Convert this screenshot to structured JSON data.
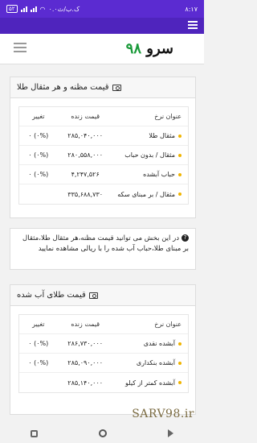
{
  "statusbar": {
    "time": "۸:۱۷",
    "speed": "۰.۰ک.ب/ث",
    "battery": "۵۲"
  },
  "header": {
    "logo_text": "سرو",
    "logo_num": "۹۸"
  },
  "gold_card": {
    "title": "قیمت مظنه و هر مثقال طلا",
    "columns": {
      "name": "عنوان نرخ",
      "price": "قیمت زنده",
      "change": "تغییر"
    },
    "rows": [
      {
        "name": "مثقال طلا",
        "price": "۲۸۵,۰۴۰,۰۰۰",
        "change": "(۰%) ۰"
      },
      {
        "name": "مثقال / بدون حباب",
        "price": "۲۸۰,۵۵۸,۰۰۰",
        "change": "(۰%) ۰"
      },
      {
        "name": "حباب آبشده",
        "price": "۴,۲۴۷,۵۲۶",
        "change": "(۰%) ۰"
      },
      {
        "name": "مثقال / بر مبنای سکه",
        "price": "۳۳۵,۶۸۸,۷۳۰",
        "change": ""
      }
    ]
  },
  "notice": {
    "text": "در این بخش می توانید قیمت مظنه،هر مثقال طلا،مثقال بر مبنای طلا،حباب آب شده را با ریالی مشاهده نمایید"
  },
  "melted_card": {
    "title": "قیمت طلای آب شده",
    "columns": {
      "name": "عنوان نرخ",
      "price": "قیمت زنده",
      "change": "تغییر"
    },
    "rows": [
      {
        "name": "آبشده نقدی",
        "price": "۲۸۶,۷۳۰,۰۰۰",
        "change": "(۰%) ۰"
      },
      {
        "name": "آبشده بنکداری",
        "price": "۲۸۵,۰۹۰,۰۰۰",
        "change": "(۰%) ۰"
      },
      {
        "name": "آبشده کمتر از کیلو",
        "price": "۲۸۵,۱۴۰,۰۰۰",
        "change": ""
      }
    ]
  },
  "watermark": "SARV98.ir"
}
